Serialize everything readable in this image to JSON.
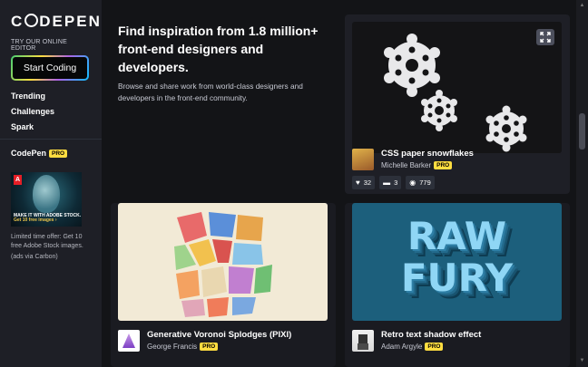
{
  "brand": {
    "logo_text_before": "C",
    "logo_text_after": "DEPEN",
    "try_label": "TRY OUR ONLINE EDITOR",
    "start_button": "Start Coding"
  },
  "nav": {
    "items": [
      "Trending",
      "Challenges",
      "Spark"
    ]
  },
  "pro_section": {
    "brand_label": "CodePen",
    "pro_label": "PRO"
  },
  "ad": {
    "image_text": "MAKE IT WITH ADOBE STOCK.",
    "image_cta": "Get 10 free images ›",
    "copy": "Limited time offer: Get 10 free Adobe Stock images.",
    "note": "(ads via Carbon)"
  },
  "hero": {
    "title": "Find inspiration from 1.8 million+ front-end designers and developers.",
    "subtitle": "Browse and share work from world-class designers and developers in the front-end community."
  },
  "cards": [
    {
      "title": "CSS paper snowflakes",
      "author": "Michelle Barker",
      "badge": "PRO",
      "likes": "32",
      "comments": "3",
      "views": "779",
      "preview_icon": "expand-icon"
    },
    {
      "title": "Generative Voronoi Splodges (PIXI)",
      "author": "George Francis",
      "badge": "PRO"
    },
    {
      "title": "Retro text shadow effect",
      "author": "Adam Argyle",
      "badge": "PRO",
      "preview_text_line1": "RAW",
      "preview_text_line2": "FURY"
    }
  ],
  "colors": {
    "background": "#131417",
    "sidebar": "#1e1f26",
    "pro_badge": "#ffdd40",
    "raw_fury_text": "#8fd6f5"
  }
}
